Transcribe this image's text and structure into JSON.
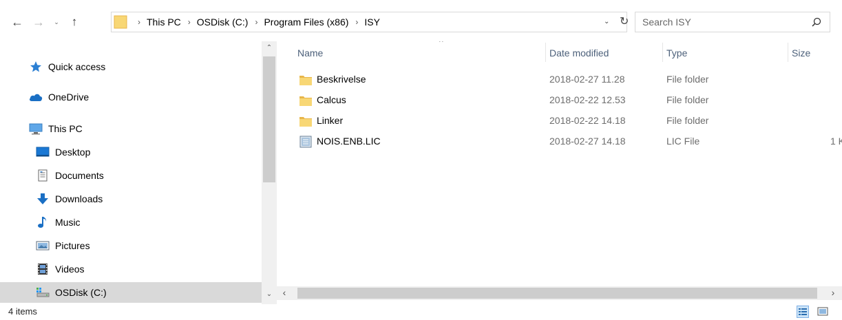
{
  "navigation": {
    "back_glyph": "←",
    "forward_glyph": "→",
    "recent_glyph": "⌄",
    "up_glyph": "↑"
  },
  "address": {
    "crumbs": [
      "This PC",
      "OSDisk (C:)",
      "Program Files (x86)",
      "ISY"
    ],
    "separator": "›",
    "dropdown_glyph": "⌄",
    "refresh_glyph": "↻"
  },
  "search": {
    "placeholder": "Search ISY"
  },
  "nav_pane": {
    "items": [
      {
        "label": "Quick access",
        "icon": "star-icon"
      },
      {
        "label": "OneDrive",
        "icon": "cloud-icon"
      },
      {
        "label": "This PC",
        "icon": "computer-icon"
      },
      {
        "label": "Desktop",
        "icon": "desktop-icon"
      },
      {
        "label": "Documents",
        "icon": "documents-icon"
      },
      {
        "label": "Downloads",
        "icon": "download-arrow-icon"
      },
      {
        "label": "Music",
        "icon": "music-note-icon"
      },
      {
        "label": "Pictures",
        "icon": "pictures-icon"
      },
      {
        "label": "Videos",
        "icon": "film-icon"
      },
      {
        "label": "OSDisk (C:)",
        "icon": "drive-icon",
        "selected": true
      }
    ],
    "scroll_up_glyph": "⌃",
    "scroll_down_glyph": "⌄"
  },
  "columns": {
    "name": "Name",
    "date": "Date modified",
    "type": "Type",
    "size": "Size",
    "sort_glyph": "^"
  },
  "files": [
    {
      "name": "Beskrivelse",
      "date": "2018-02-27 11.28",
      "type": "File folder",
      "size": "",
      "icon": "folder-icon"
    },
    {
      "name": "Calcus",
      "date": "2018-02-22 12.53",
      "type": "File folder",
      "size": "",
      "icon": "folder-icon"
    },
    {
      "name": "Linker",
      "date": "2018-02-22 14.18",
      "type": "File folder",
      "size": "",
      "icon": "folder-icon"
    },
    {
      "name": "NOIS.ENB.LIC",
      "date": "2018-02-27 14.18",
      "type": "LIC File",
      "size": "1 K",
      "icon": "file-icon"
    }
  ],
  "hscroll": {
    "left_glyph": "‹",
    "right_glyph": "›"
  },
  "status": {
    "item_count": "4 items"
  },
  "colors": {
    "folder_yellow": "#f8d775",
    "folder_dark": "#e8b64a",
    "selected_bg": "#d9d9d9",
    "header_text": "#4c607a",
    "accent_blue": "#1979ca"
  }
}
